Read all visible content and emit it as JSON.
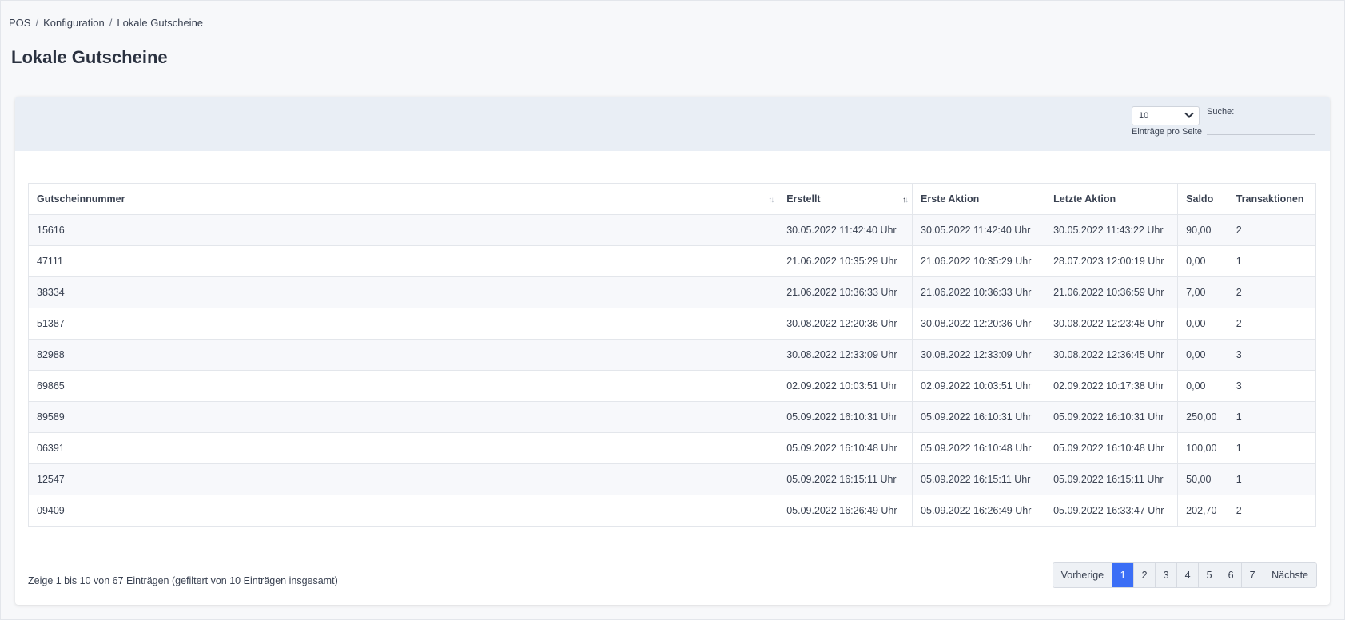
{
  "breadcrumb": {
    "items": [
      "POS",
      "Konfiguration",
      "Lokale Gutscheine"
    ]
  },
  "page_title": "Lokale Gutscheine",
  "controls": {
    "length_value": "10",
    "length_label": "Einträge pro Seite",
    "search_label": "Suche:",
    "search_value": ""
  },
  "table": {
    "columns": [
      "Gutscheinnummer",
      "Erstellt",
      "Erste Aktion",
      "Letzte Aktion",
      "Saldo",
      "Transaktionen"
    ],
    "rows": [
      [
        "15616",
        "30.05.2022 11:42:40 Uhr",
        "30.05.2022 11:42:40 Uhr",
        "30.05.2022 11:43:22 Uhr",
        "90,00",
        "2"
      ],
      [
        "47111",
        "21.06.2022 10:35:29 Uhr",
        "21.06.2022 10:35:29 Uhr",
        "28.07.2023 12:00:19 Uhr",
        "0,00",
        "1"
      ],
      [
        "38334",
        "21.06.2022 10:36:33 Uhr",
        "21.06.2022 10:36:33 Uhr",
        "21.06.2022 10:36:59 Uhr",
        "7,00",
        "2"
      ],
      [
        "51387",
        "30.08.2022 12:20:36 Uhr",
        "30.08.2022 12:20:36 Uhr",
        "30.08.2022 12:23:48 Uhr",
        "0,00",
        "2"
      ],
      [
        "82988",
        "30.08.2022 12:33:09 Uhr",
        "30.08.2022 12:33:09 Uhr",
        "30.08.2022 12:36:45 Uhr",
        "0,00",
        "3"
      ],
      [
        "69865",
        "02.09.2022 10:03:51 Uhr",
        "02.09.2022 10:03:51 Uhr",
        "02.09.2022 10:17:38 Uhr",
        "0,00",
        "3"
      ],
      [
        "89589",
        "05.09.2022 16:10:31 Uhr",
        "05.09.2022 16:10:31 Uhr",
        "05.09.2022 16:10:31 Uhr",
        "250,00",
        "1"
      ],
      [
        "06391",
        "05.09.2022 16:10:48 Uhr",
        "05.09.2022 16:10:48 Uhr",
        "05.09.2022 16:10:48 Uhr",
        "100,00",
        "1"
      ],
      [
        "12547",
        "05.09.2022 16:15:11 Uhr",
        "05.09.2022 16:15:11 Uhr",
        "05.09.2022 16:15:11 Uhr",
        "50,00",
        "1"
      ],
      [
        "09409",
        "05.09.2022 16:26:49 Uhr",
        "05.09.2022 16:26:49 Uhr",
        "05.09.2022 16:33:47 Uhr",
        "202,70",
        "2"
      ]
    ]
  },
  "info_text": "Zeige 1 bis 10 von 67 Einträgen (gefiltert von 10 Einträgen insgesamt)",
  "pagination": {
    "prev": "Vorherige",
    "pages": [
      "1",
      "2",
      "3",
      "4",
      "5",
      "6",
      "7"
    ],
    "current": "1",
    "next": "Nächste"
  },
  "colors": {
    "accent": "#3b6ef6",
    "header_bg": "#e9eef5"
  }
}
